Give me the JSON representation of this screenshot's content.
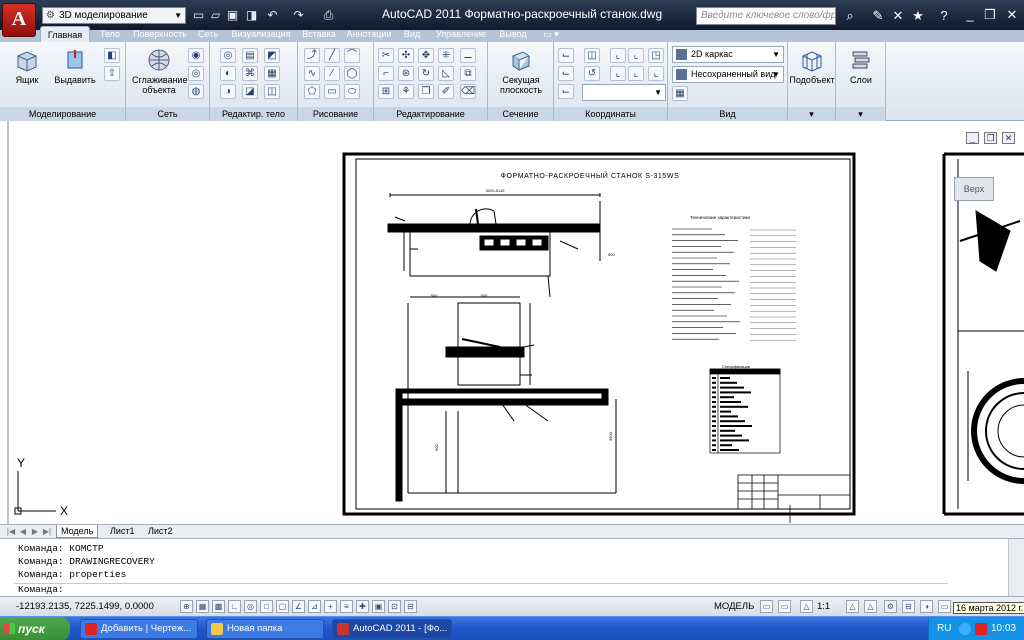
{
  "titlebar": {
    "app_logo": "A",
    "workspace": "3D моделирование",
    "title": "AutoCAD 2011    Форматно-раскроечный станок.dwg",
    "search_placeholder": "Введите ключевое слово/фразу"
  },
  "tabs": [
    "Главная",
    "Тело",
    "Поверхность",
    "Сеть",
    "Визуализация",
    "Вставка",
    "Аннотации",
    "Вид",
    "Управление",
    "Вывод"
  ],
  "ribbon": {
    "box_label": "Ящик",
    "extrude_label": "Выдавить",
    "smooth_label": "Сглаживание объекта",
    "section_plane_label": "Секущая плоскость",
    "subobject_label": "Подобъект",
    "layers_label": "Слои",
    "visual_style": "2D каркас",
    "view_name": "Несохраненный вид",
    "panels": [
      "Моделирование",
      "Сеть",
      "Редактир. тело",
      "Рисование",
      "Редактирование",
      "Сечение",
      "Координаты",
      "Вид"
    ]
  },
  "drawing": {
    "title": "ФОРМАТНО-РАСКРОЕЧНЫЙ СТАНОК S-315WS",
    "specs_heading": "Технические характеристики",
    "spec_table_heading": "Спецификация",
    "dim_top": "3200-5110",
    "dim_left": "500",
    "dim_mid": "500",
    "dim_height": "900",
    "dim_bottom": "3500"
  },
  "viewcube": {
    "label": "Верх"
  },
  "layout_tabs": [
    "Модель",
    "Лист1",
    "Лист2"
  ],
  "command": {
    "history": [
      "Команда: КОМСТР",
      "Команда: DRAWINGRECOVERY",
      "Команда: properties"
    ],
    "prompt": "Команда:"
  },
  "status": {
    "coords": "-12193.2135, 7225.1499, 0.0000",
    "model": "МОДЕЛЬ",
    "scale": "1:1",
    "date_tooltip": "16 марта 2012 г."
  },
  "taskbar": {
    "start": "пуск",
    "items": [
      "Добавить | Чертеж...",
      "Новая папка",
      "AutoCAD 2011 - [Фо..."
    ],
    "lang": "RU",
    "clock": "10:03"
  },
  "colors": {
    "title_bg": "#0f1a2c",
    "ribbon_bg": "#dbe4ef",
    "taskbar": "#2257c9",
    "start": "#3a8e36"
  }
}
